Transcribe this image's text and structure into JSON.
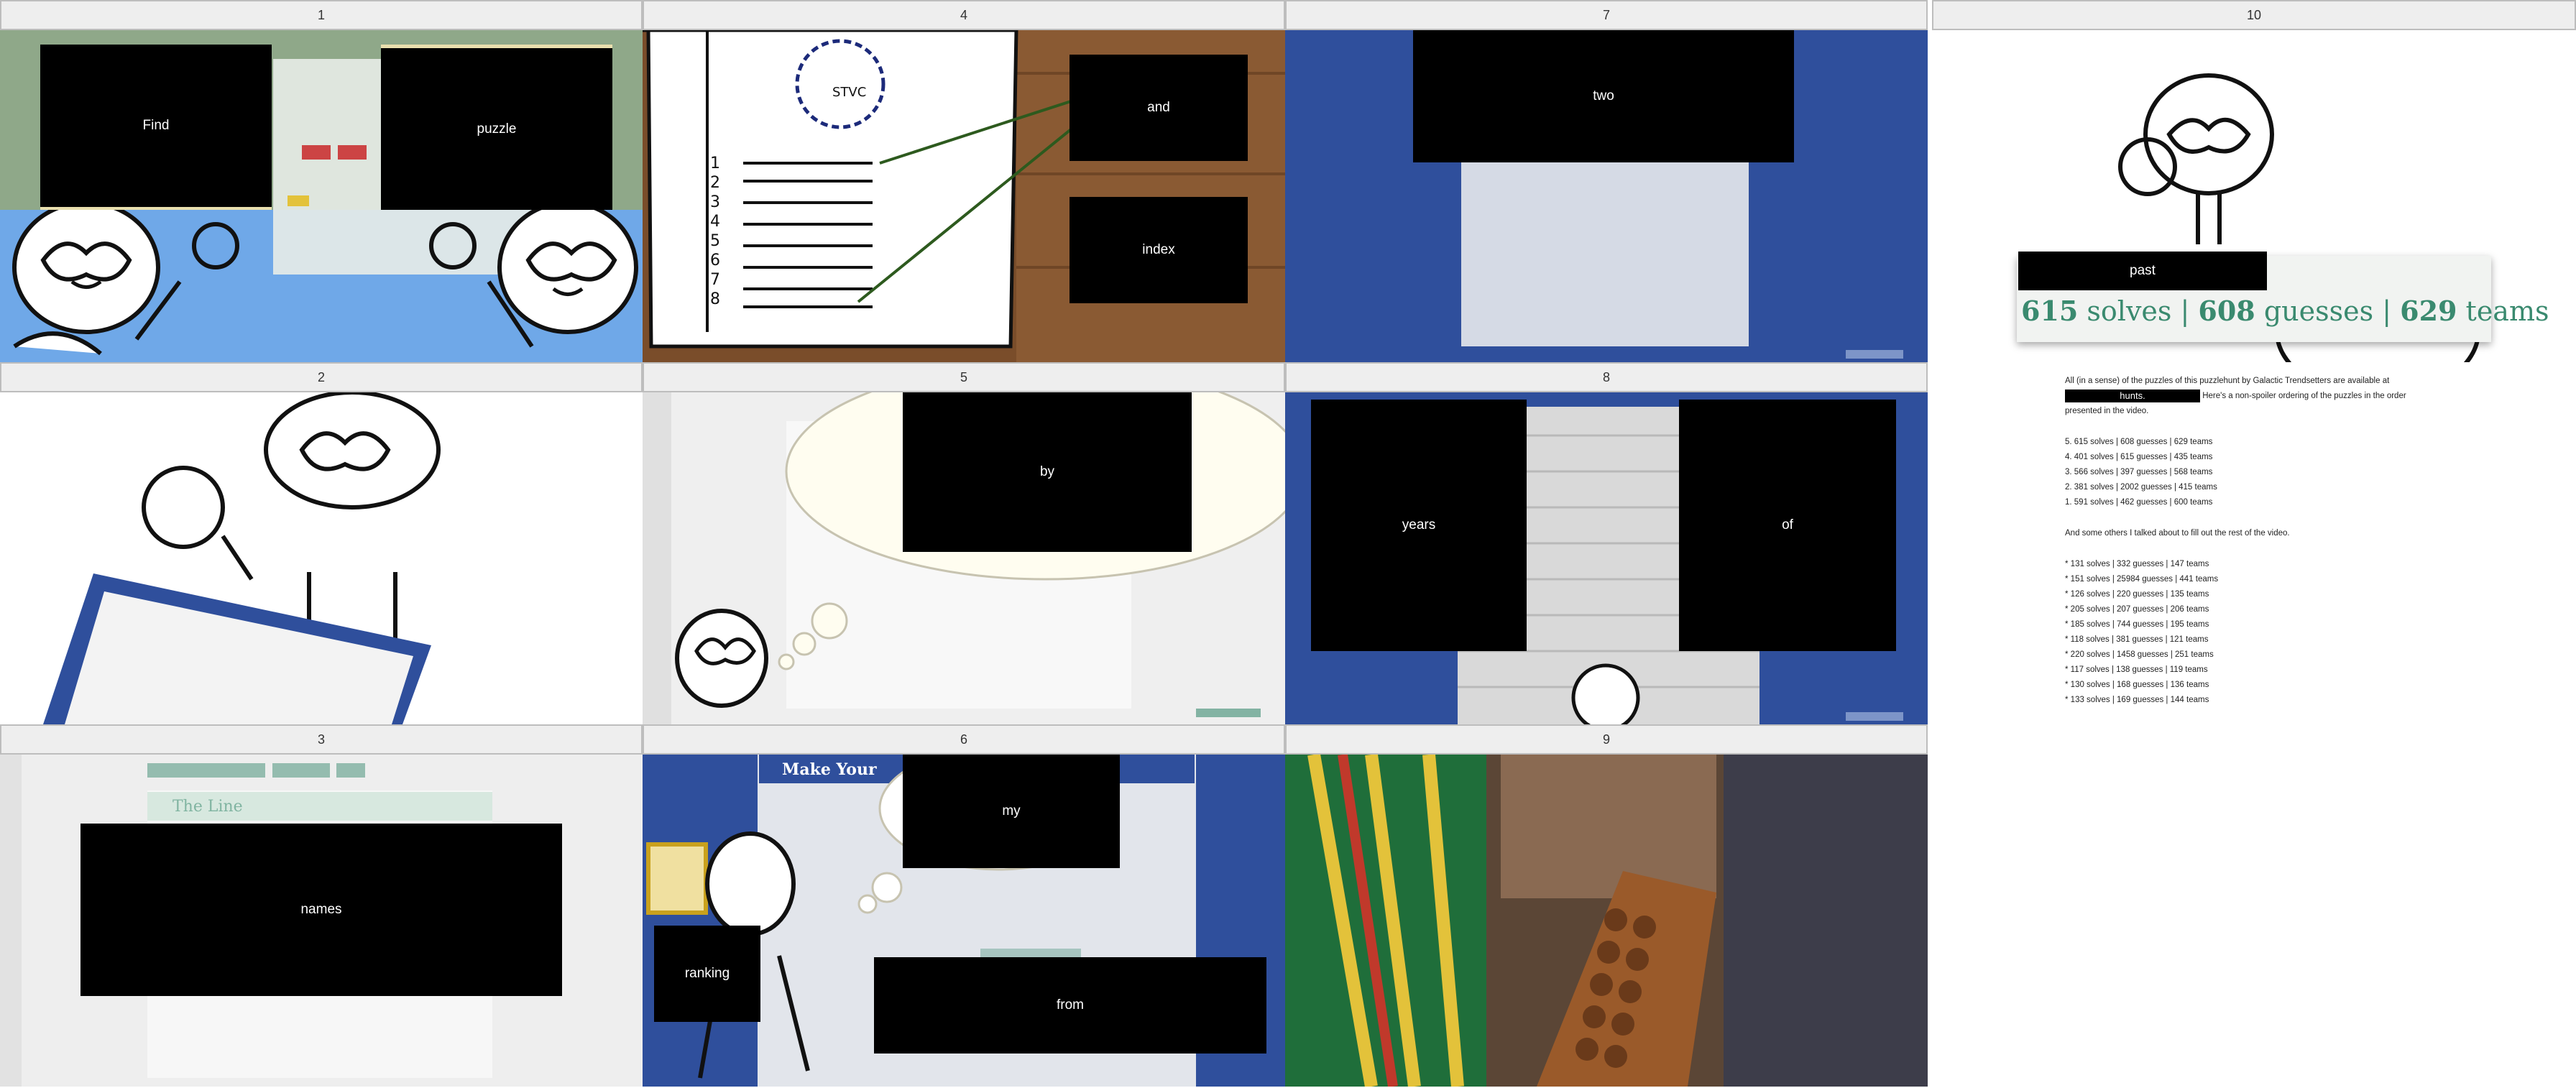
{
  "panels": [
    {
      "number": "1",
      "redactions": [
        "Find",
        "puzzle"
      ]
    },
    {
      "number": "4",
      "redactions": [
        "and",
        "index"
      ],
      "sketch_text": "STVC",
      "list_numbers": [
        "1",
        "2",
        "3",
        "4",
        "5",
        "6",
        "7",
        "8"
      ]
    },
    {
      "number": "7",
      "redactions": [
        "two"
      ]
    },
    {
      "number": "2"
    },
    {
      "number": "5",
      "redactions": [
        "by"
      ]
    },
    {
      "number": "8",
      "redactions": [
        "years",
        "of"
      ]
    },
    {
      "number": "3",
      "redactions": [
        "names"
      ],
      "heading": "The Line"
    },
    {
      "number": "6",
      "redactions": [
        "my",
        "ranking",
        "from"
      ],
      "heading": "Make Your"
    },
    {
      "number": "9"
    }
  ],
  "panel10": {
    "number": "10",
    "banner_redaction": "past",
    "stats": {
      "solves": "615",
      "guesses": "608",
      "teams": "629",
      "solves_label": "solves",
      "guesses_label": "guesses",
      "teams_label": "teams",
      "sep": "|"
    },
    "intro_line1": "All (in a sense) of the puzzles of this puzzlehunt by Galactic Trendsetters are available at",
    "intro_redaction": "hunts.",
    "intro_line2": "Here's a non-spoiler ordering of the puzzles in the order",
    "intro_line3": "presented in the video.",
    "ordered": [
      "5. 615 solves | 608 guesses | 629 teams",
      "4. 401 solves | 615 guesses | 435 teams",
      "3. 566 solves | 397 guesses | 568 teams",
      "2. 381 solves | 2002 guesses | 415 teams",
      "1. 591 solves | 462 guesses | 600 teams"
    ],
    "others_heading": "And some others I talked about to fill out the rest of the video.",
    "others": [
      "* 131 solves | 332 guesses | 147 teams",
      "* 151 solves | 25984 guesses | 441 teams",
      "* 126 solves | 220 guesses | 135 teams",
      "* 205 solves | 207 guesses | 206 teams",
      "* 185 solves | 744 guesses | 195 teams",
      "* 118 solves | 381 guesses | 121 teams",
      "* 220 solves | 1458 guesses | 251 teams",
      "* 117 solves | 138 guesses | 119 teams",
      "* 130 solves | 168 guesses | 136 teams",
      "* 133 solves | 169 guesses | 144 teams"
    ]
  },
  "colors": {
    "blue_bg": "#2f4f9c",
    "wood": "#7a4d2a",
    "teal": "#3a8a6f",
    "sky": "#6fa8e8"
  }
}
